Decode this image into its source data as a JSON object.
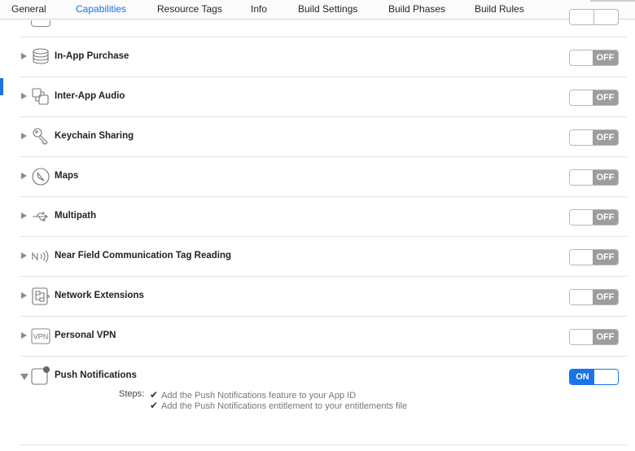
{
  "tabs": [
    {
      "label": "General"
    },
    {
      "label": "Capabilities",
      "active": true
    },
    {
      "label": "Resource Tags"
    },
    {
      "label": "Info"
    },
    {
      "label": "Build Settings"
    },
    {
      "label": "Build Phases"
    },
    {
      "label": "Build Rules"
    }
  ],
  "capabilities": [
    {
      "label": "In-App Purchase",
      "icon": "coin-stack-icon",
      "state": "OFF"
    },
    {
      "label": "Inter-App Audio",
      "icon": "inter-app-audio-icon",
      "state": "OFF"
    },
    {
      "label": "Keychain Sharing",
      "icon": "key-icon",
      "state": "OFF"
    },
    {
      "label": "Maps",
      "icon": "compass-icon",
      "state": "OFF"
    },
    {
      "label": "Multipath",
      "icon": "usb-branch-icon",
      "state": "OFF"
    },
    {
      "label": "Near Field Communication Tag Reading",
      "icon": "nfc-icon",
      "state": "OFF"
    },
    {
      "label": "Network Extensions",
      "icon": "network-extension-icon",
      "state": "OFF"
    },
    {
      "label": "Personal VPN",
      "icon": "vpn-icon",
      "state": "OFF"
    },
    {
      "label": "Push Notifications",
      "icon": "notification-badge-icon",
      "state": "ON"
    }
  ],
  "push_steps": {
    "label": "Steps:",
    "items": [
      "Add the Push Notifications feature to your App ID",
      "Add the Push Notifications entitlement to your entitlements file"
    ]
  },
  "colors": {
    "accent": "#1a73e8",
    "off": "#9d9d9d"
  }
}
